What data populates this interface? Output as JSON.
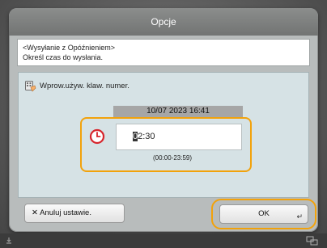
{
  "window": {
    "title": "Opcje"
  },
  "instruction": {
    "line1": "<Wysyłanie z Opóźnieniem>",
    "line2": "Określ czas do wysłania."
  },
  "hint": {
    "text": "Wprow.używ. klaw. numer.",
    "icon": "numeric-keypad-icon"
  },
  "datetime": {
    "current": "10/07 2023 16:41"
  },
  "time_input": {
    "cursor_char": "0",
    "rest": "2:30",
    "range": "(00:00-23:59)",
    "icon": "clock-icon"
  },
  "buttons": {
    "cancel_label": "Anuluj ustawie.",
    "ok_label": "OK"
  },
  "colors": {
    "accent_highlight": "#f2a20b",
    "title_bar": "#7d7f7e",
    "clock_red": "#d7262d"
  }
}
